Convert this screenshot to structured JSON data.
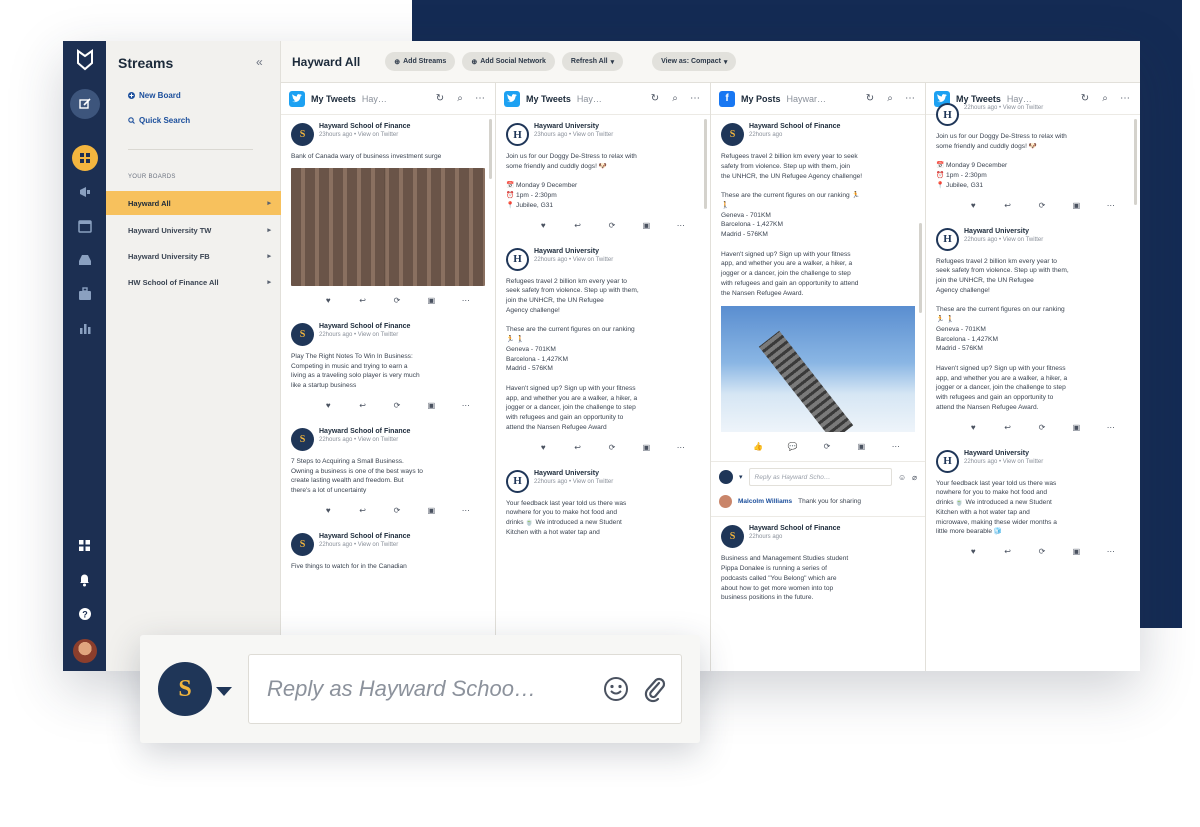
{
  "colors": {
    "navy": "#142b54",
    "rail": "#1c2f52",
    "accent": "#f7c15d",
    "link": "#1c4f9c"
  },
  "sidebar": {
    "title": "Streams",
    "collapse_icon": "«",
    "new_board": "New Board",
    "quick_search": "Quick Search",
    "section_label": "YOUR BOARDS",
    "boards": [
      {
        "label": "Hayward All",
        "active": true
      },
      {
        "label": "Hayward University TW"
      },
      {
        "label": "Hayward University FB"
      },
      {
        "label": "HW School of Finance All"
      }
    ]
  },
  "topbar": {
    "title": "Hayward All",
    "add_streams": "Add Streams",
    "add_social": "Add Social Network",
    "refresh": "Refresh All",
    "view": "View as: Compact"
  },
  "columns": [
    {
      "network": "twitter-icon",
      "title": "My Tweets",
      "subtitle": "Hay…",
      "posts": [
        {
          "author": "Hayward School of Finance",
          "meta": "23hours ago  •  View on Twitter",
          "text": "Bank of Canada wary of business investment surge"
        },
        {
          "author": "Hayward School of Finance",
          "meta": "22hours ago  •  View on Twitter",
          "text": "Play The Right Notes To Win In Business:\nCompeting in music and trying to earn a\nliving as a traveling solo player is very much\nlike a startup business"
        },
        {
          "author": "Hayward School of Finance",
          "meta": "22hours ago  •  View on Twitter",
          "text": "7 Steps to Acquiring a Small Business.\nOwning a business is one of the best ways to\ncreate lasting wealth and freedom. But\nthere's a lot of uncertainty"
        },
        {
          "author": "Hayward School of Finance",
          "meta": "22hours ago  •  View on Twitter",
          "text": "Five things to watch for in the Canadian"
        }
      ]
    },
    {
      "network": "twitter-icon",
      "title": "My Tweets",
      "subtitle": "Hay…",
      "posts": [
        {
          "author": "Hayward University",
          "meta": "23hours ago  •  View on Twitter",
          "text": "Join us for our Doggy De-Stress to relax with\nsome friendly and cuddly dogs! 🐶\n\n📅  Monday 9 December\n⏰  1pm - 2:30pm\n📍  Jubilee, G31"
        },
        {
          "author": "Hayward University",
          "meta": "22hours ago  •  View on Twitter",
          "text": "Refugees travel 2 billion km every year to\nseek safety from violence. Step up with them,\njoin the UNHCR, the UN Refugee\nAgency challenge!\n\nThese are the current figures on our ranking\n🏃 🚶\nGeneva - 701KM\nBarcelona - 1,427KM\nMadrid - 576KM\n\nHaven't signed up? Sign up with your fitness\napp, and whether you are a walker, a hiker, a\njogger or a dancer, join the challenge to step\nwith refugees and gain an opportunity to\nattend the Nansen Refugee Award"
        },
        {
          "author": "Hayward University",
          "meta": "22hours ago  •  View on Twitter",
          "text": "Your feedback last year told us there was\nnowhere for you to make hot food and\ndrinks 🍵 We introduced a new Student\nKitchen with a hot water tap and"
        }
      ]
    },
    {
      "network": "facebook-icon",
      "title": "My Posts",
      "subtitle": "Haywar…",
      "posts": [
        {
          "author": "Hayward School of Finance",
          "meta": "22hours ago",
          "text": "Refugees travel 2 billion km every year to seek\nsafety from violence. Step up with them, join\nthe UNHCR, the UN Refugee Agency challenge!\n\nThese are the current figures on our ranking 🏃\n🚶\nGeneva - 701KM\nBarcelona - 1,427KM\nMadrid - 576KM\n\nHaven't signed up? Sign up with your fitness\napp, and whether you are a walker, a hiker, a\njogger or a dancer, join the challenge to step\nwith refugees and gain an opportunity to attend\nthe Nansen Refugee Award."
        },
        {
          "author": "Hayward School of Finance",
          "meta": "22hours ago",
          "text": "Business and Management Studies student\nPippa Donalee is running a series of\npodcasts called \"You Belong\" which are\nabout how to get more women into top\nbusiness positions in the future."
        }
      ],
      "reply_placeholder": "Reply as Hayward Scho…",
      "comment_author": "Malcolm Williams",
      "comment_text": "Thank you for sharing"
    },
    {
      "network": "twitter-icon",
      "title": "My Tweets",
      "subtitle": "Hay…",
      "posts": [
        {
          "author": "",
          "meta": "22hours ago  •  View on Twitter",
          "text": "Join us for our Doggy De-Stress to relax with\nsome friendly and cuddly dogs! 🐶\n\n📅  Monday 9 December\n⏰  1pm - 2:30pm\n📍  Jubilee, G31"
        },
        {
          "author": "Hayward University",
          "meta": "22hours ago  •  View on Twitter",
          "text": "Refugees travel 2 billion km every year to\nseek safety from violence. Step up with them,\njoin the UNHCR, the UN Refugee\nAgency challenge!\n\nThese are the current figures on our ranking\n🏃 🚶\nGeneva - 701KM\nBarcelona - 1,427KM\nMadrid - 576KM\n\nHaven't signed up? Sign up with your fitness\napp, and whether you are a walker, a hiker, a\njogger or a dancer, join the challenge to step\nwith refugees and gain an opportunity to\nattend the Nansen Refugee Award."
        },
        {
          "author": "Hayward University",
          "meta": "22hours ago  •  View on Twitter",
          "text": "Your feedback last year told us there was\nnowhere for you to make hot food and\ndrinks 🍵 We introduced a new Student\nKitchen with a hot water tap and\nmicrowave, making these wider months a\nlittle more bearable 🧊"
        }
      ]
    }
  ],
  "floating_reply": {
    "placeholder": "Reply as Hayward Schoo…"
  }
}
